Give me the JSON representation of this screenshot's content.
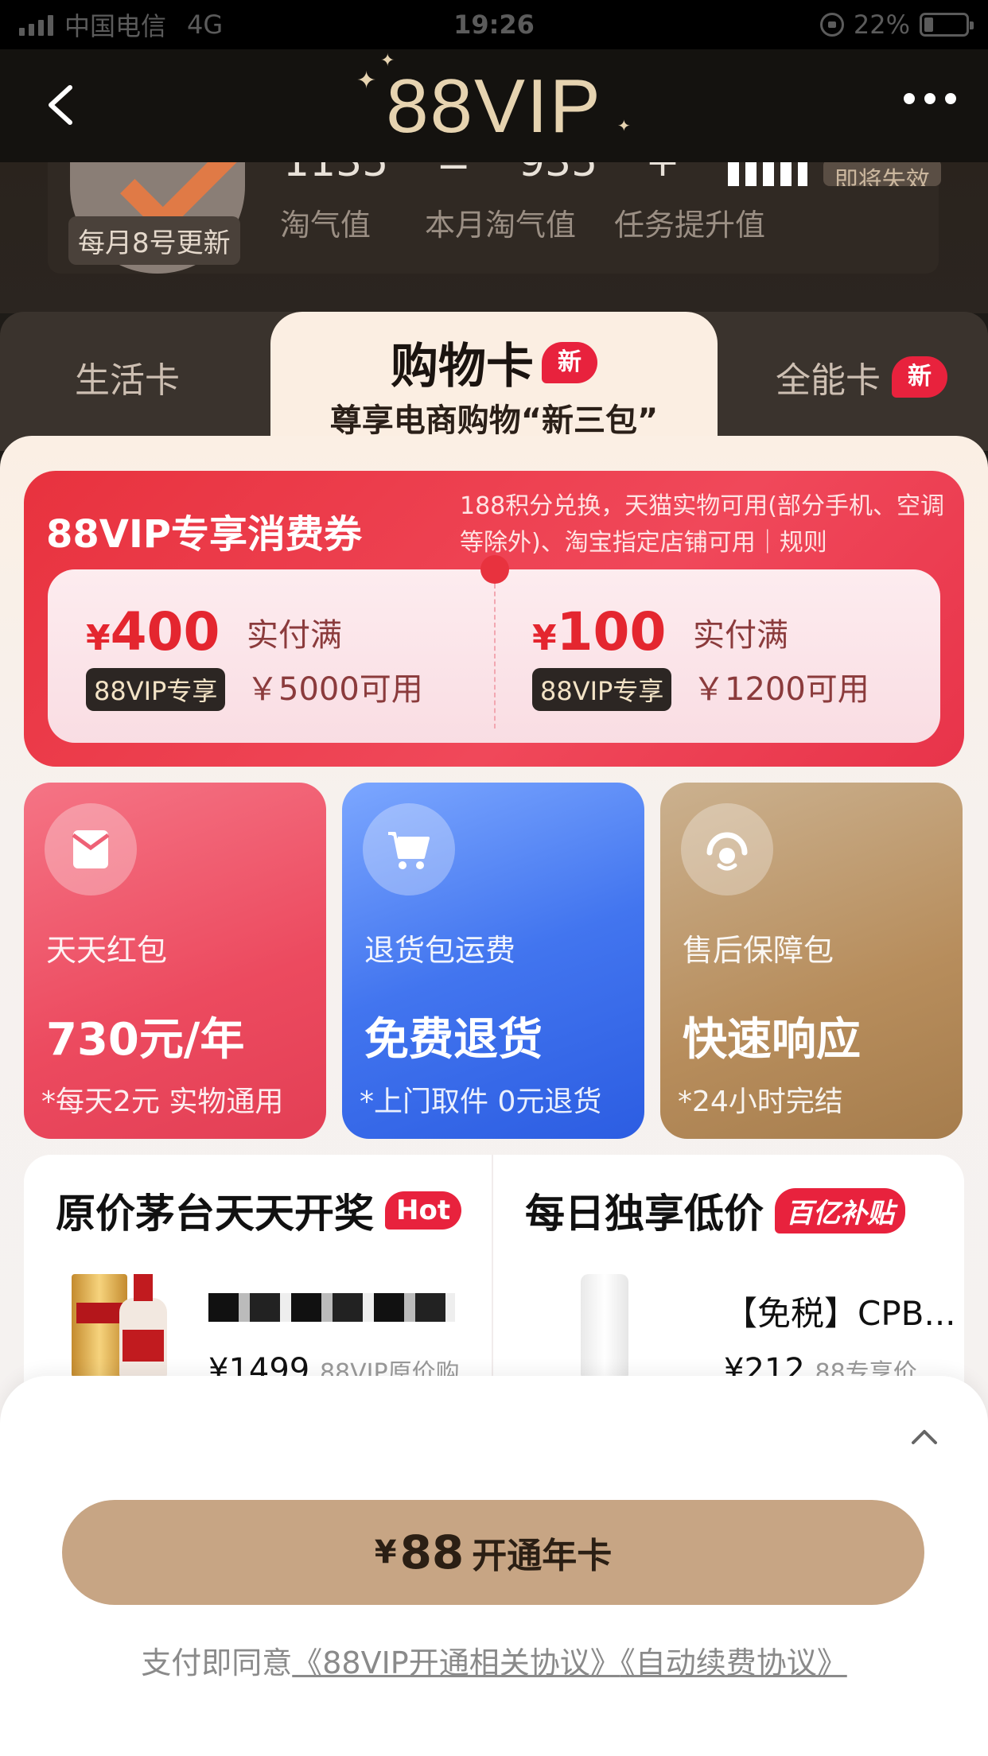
{
  "status_bar": {
    "carrier": "中国电信",
    "network": "4G",
    "time": "19:26",
    "battery": "22%"
  },
  "nav": {
    "title": "88VIP"
  },
  "member": {
    "update_badge": "每月8号更新",
    "values": [
      "1135",
      "=",
      "935",
      "+"
    ],
    "soon_badge": "即将失效",
    "labels": [
      "淘气值",
      "本月淘气值",
      "任务提升值"
    ]
  },
  "tabs": {
    "life": "生活卡",
    "shopping": "购物卡",
    "shopping_sub": "尊享电商购物“新三包”",
    "all": "全能卡",
    "new_badge": "新"
  },
  "coupon": {
    "title": "88VIP专享消费券",
    "desc": "188积分兑换，天猫实物可用(部分手机、空调等除外)、淘宝指定店铺可用｜规则",
    "items": [
      {
        "symbol": "¥",
        "amount": "400",
        "tag": "88VIP专享",
        "cond1": "实付满",
        "cond2": "￥5000可用"
      },
      {
        "symbol": "¥",
        "amount": "100",
        "tag": "88VIP专享",
        "cond1": "实付满",
        "cond2": "￥1200可用"
      }
    ]
  },
  "services": [
    {
      "name": "天天红包",
      "value": "730元/年",
      "note": "*每天2元 实物通用",
      "icon": "red-packet-icon"
    },
    {
      "name": "退货包运费",
      "value": "免费退货",
      "note": "*上门取件 0元退货",
      "icon": "cart-icon"
    },
    {
      "name": "售后保障包",
      "value": "快速响应",
      "note": "*24小时完结",
      "icon": "service-headset-icon"
    }
  ],
  "products": {
    "left": {
      "title": "原价茅台天天开奖",
      "badge": "Hot",
      "price": "¥1499",
      "price_note": "88VIP原价购"
    },
    "right": {
      "title": "每日独享低价",
      "badge": "百亿补贴",
      "name": "【免税】CPB...",
      "price": "¥212",
      "price_note": "88专享价"
    }
  },
  "bottom": {
    "yen": "¥",
    "price": "88",
    "label": "开通年卡",
    "agreement_prefix": "支付即同意",
    "agreement_link1": "《88VIP开通相关协议》",
    "agreement_link2": "《自动续费协议》"
  },
  "colors": {
    "gold": "#c7a584",
    "red": "#e8323e",
    "blue": "#4275ef"
  }
}
